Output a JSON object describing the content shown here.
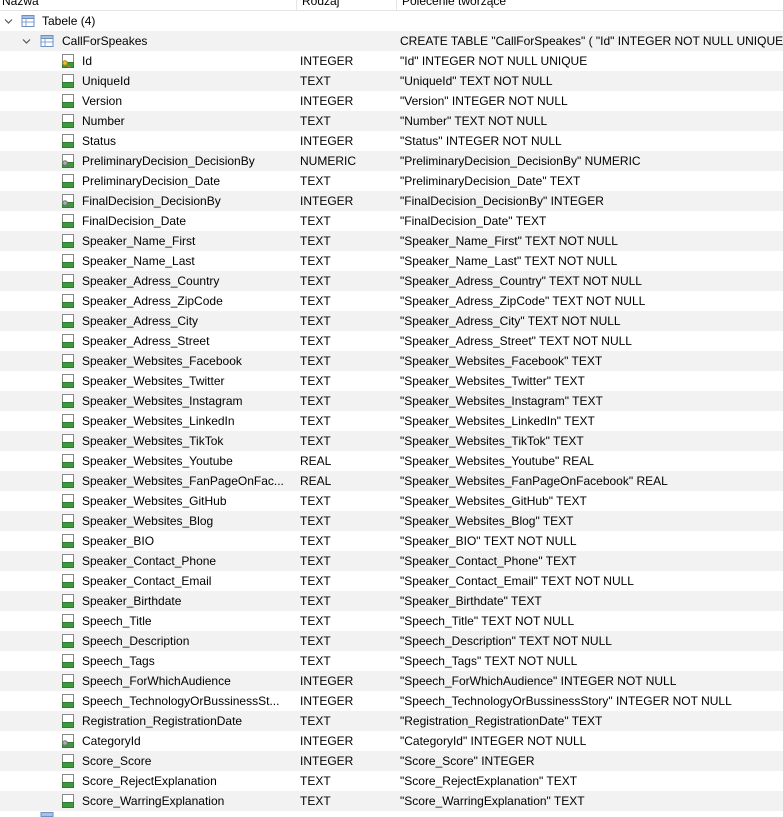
{
  "headers": {
    "name": "Nazwa",
    "type": "Rodzaj",
    "sql": "Polecenie tworzące"
  },
  "tables_group": {
    "label": "Tabele (4)"
  },
  "table": {
    "name": "CallForSpeakes",
    "sql": "CREATE TABLE \"CallForSpeakes\" ( \"Id\" INTEGER NOT NULL UNIQUE"
  },
  "columns": [
    {
      "name": "Id",
      "type": "INTEGER",
      "sql": "\"Id\" INTEGER NOT NULL UNIQUE",
      "icon": "key-column-icon"
    },
    {
      "name": "UniqueId",
      "type": "TEXT",
      "sql": "\"UniqueId\" TEXT NOT NULL",
      "icon": "column-icon"
    },
    {
      "name": "Version",
      "type": "INTEGER",
      "sql": "\"Version\" INTEGER NOT NULL",
      "icon": "column-icon"
    },
    {
      "name": "Number",
      "type": "TEXT",
      "sql": "\"Number\" TEXT NOT NULL",
      "icon": "column-icon"
    },
    {
      "name": "Status",
      "type": "INTEGER",
      "sql": "\"Status\" INTEGER NOT NULL",
      "icon": "column-icon"
    },
    {
      "name": "PreliminaryDecision_DecisionBy",
      "type": "NUMERIC",
      "sql": "\"PreliminaryDecision_DecisionBy\" NUMERIC",
      "icon": "foreign-key-column-icon"
    },
    {
      "name": "PreliminaryDecision_Date",
      "type": "TEXT",
      "sql": "\"PreliminaryDecision_Date\" TEXT",
      "icon": "column-icon"
    },
    {
      "name": "FinalDecision_DecisionBy",
      "type": "INTEGER",
      "sql": "\"FinalDecision_DecisionBy\" INTEGER",
      "icon": "foreign-key-column-icon"
    },
    {
      "name": "FinalDecision_Date",
      "type": "TEXT",
      "sql": "\"FinalDecision_Date\" TEXT",
      "icon": "column-icon"
    },
    {
      "name": "Speaker_Name_First",
      "type": "TEXT",
      "sql": "\"Speaker_Name_First\" TEXT NOT NULL",
      "icon": "column-icon"
    },
    {
      "name": "Speaker_Name_Last",
      "type": "TEXT",
      "sql": "\"Speaker_Name_Last\" TEXT NOT NULL",
      "icon": "column-icon"
    },
    {
      "name": "Speaker_Adress_Country",
      "type": "TEXT",
      "sql": "\"Speaker_Adress_Country\" TEXT NOT NULL",
      "icon": "column-icon"
    },
    {
      "name": "Speaker_Adress_ZipCode",
      "type": "TEXT",
      "sql": "\"Speaker_Adress_ZipCode\" TEXT NOT NULL",
      "icon": "column-icon"
    },
    {
      "name": "Speaker_Adress_City",
      "type": "TEXT",
      "sql": "\"Speaker_Adress_City\" TEXT NOT NULL",
      "icon": "column-icon"
    },
    {
      "name": "Speaker_Adress_Street",
      "type": "TEXT",
      "sql": "\"Speaker_Adress_Street\" TEXT NOT NULL",
      "icon": "column-icon"
    },
    {
      "name": "Speaker_Websites_Facebook",
      "type": "TEXT",
      "sql": "\"Speaker_Websites_Facebook\" TEXT",
      "icon": "column-icon"
    },
    {
      "name": "Speaker_Websites_Twitter",
      "type": "TEXT",
      "sql": "\"Speaker_Websites_Twitter\" TEXT",
      "icon": "column-icon"
    },
    {
      "name": "Speaker_Websites_Instagram",
      "type": "TEXT",
      "sql": "\"Speaker_Websites_Instagram\" TEXT",
      "icon": "column-icon"
    },
    {
      "name": "Speaker_Websites_LinkedIn",
      "type": "TEXT",
      "sql": "\"Speaker_Websites_LinkedIn\" TEXT",
      "icon": "column-icon"
    },
    {
      "name": "Speaker_Websites_TikTok",
      "type": "TEXT",
      "sql": "\"Speaker_Websites_TikTok\" TEXT",
      "icon": "column-icon"
    },
    {
      "name": "Speaker_Websites_Youtube",
      "type": "REAL",
      "sql": "\"Speaker_Websites_Youtube\" REAL",
      "icon": "column-icon"
    },
    {
      "name": "Speaker_Websites_FanPageOnFac...",
      "type": "REAL",
      "sql": "\"Speaker_Websites_FanPageOnFacebook\" REAL",
      "icon": "column-icon"
    },
    {
      "name": "Speaker_Websites_GitHub",
      "type": "TEXT",
      "sql": "\"Speaker_Websites_GitHub\" TEXT",
      "icon": "column-icon"
    },
    {
      "name": "Speaker_Websites_Blog",
      "type": "TEXT",
      "sql": "\"Speaker_Websites_Blog\" TEXT",
      "icon": "column-icon"
    },
    {
      "name": "Speaker_BIO",
      "type": "TEXT",
      "sql": "\"Speaker_BIO\" TEXT NOT NULL",
      "icon": "column-icon"
    },
    {
      "name": "Speaker_Contact_Phone",
      "type": "TEXT",
      "sql": "\"Speaker_Contact_Phone\" TEXT",
      "icon": "column-icon"
    },
    {
      "name": "Speaker_Contact_Email",
      "type": "TEXT",
      "sql": "\"Speaker_Contact_Email\" TEXT NOT NULL",
      "icon": "column-icon"
    },
    {
      "name": "Speaker_Birthdate",
      "type": "TEXT",
      "sql": "\"Speaker_Birthdate\" TEXT",
      "icon": "column-icon"
    },
    {
      "name": "Speech_Title",
      "type": "TEXT",
      "sql": "\"Speech_Title\" TEXT NOT NULL",
      "icon": "column-icon"
    },
    {
      "name": "Speech_Description",
      "type": "TEXT",
      "sql": "\"Speech_Description\" TEXT NOT NULL",
      "icon": "column-icon"
    },
    {
      "name": "Speech_Tags",
      "type": "TEXT",
      "sql": "\"Speech_Tags\" TEXT NOT NULL",
      "icon": "column-icon"
    },
    {
      "name": "Speech_ForWhichAudience",
      "type": "INTEGER",
      "sql": "\"Speech_ForWhichAudience\" INTEGER NOT NULL",
      "icon": "column-icon"
    },
    {
      "name": "Speech_TechnologyOrBussinessSt...",
      "type": "INTEGER",
      "sql": "\"Speech_TechnologyOrBussinessStory\" INTEGER NOT NULL",
      "icon": "column-icon"
    },
    {
      "name": "Registration_RegistrationDate",
      "type": "TEXT",
      "sql": "\"Registration_RegistrationDate\" TEXT",
      "icon": "column-icon"
    },
    {
      "name": "CategoryId",
      "type": "INTEGER",
      "sql": "\"CategoryId\" INTEGER NOT NULL",
      "icon": "foreign-key-column-icon"
    },
    {
      "name": "Score_Score",
      "type": "INTEGER",
      "sql": "\"Score_Score\" INTEGER",
      "icon": "column-icon"
    },
    {
      "name": "Score_RejectExplanation",
      "type": "TEXT",
      "sql": "\"Score_RejectExplanation\" TEXT",
      "icon": "column-icon"
    },
    {
      "name": "Score_WarringExplanation",
      "type": "TEXT",
      "sql": "\"Score_WarringExplanation\" TEXT",
      "icon": "column-icon"
    }
  ],
  "colors": {
    "stripe": "#f2f2f2",
    "arrow": "#555555",
    "column_icon_green": "#3e9a3e",
    "key_yellow": "#e0b020",
    "table_icon_blue": "#6d8fc4"
  }
}
